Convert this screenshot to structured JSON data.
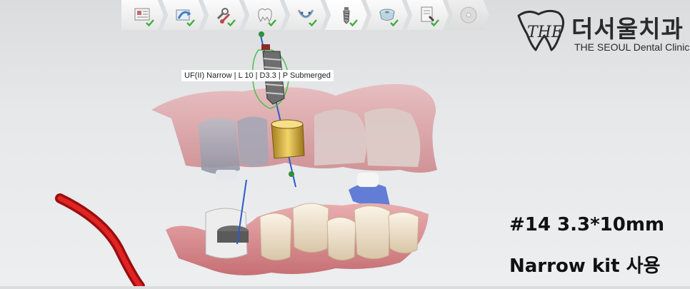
{
  "toolbar": {
    "steps": [
      {
        "icon": "patient-info-icon",
        "status": "done"
      },
      {
        "icon": "scan-import-icon",
        "status": "done"
      },
      {
        "icon": "tools-icon",
        "status": "done"
      },
      {
        "icon": "crown-icon",
        "status": "done"
      },
      {
        "icon": "nerve-canal-icon",
        "status": "done"
      },
      {
        "icon": "implant-icon",
        "status": "done"
      },
      {
        "icon": "sleeve-icon",
        "status": "done"
      },
      {
        "icon": "report-icon",
        "status": "done"
      },
      {
        "icon": "disc-export-icon",
        "status": "pending"
      }
    ]
  },
  "logo": {
    "mark": "THE",
    "name_kr": "더서울치과",
    "name_en": "THE SEOUL Dental Clinic"
  },
  "viewport": {
    "implant_tooltip": "UF(II) Narrow | L 10 | D3.3 | P Submerged"
  },
  "annotation": {
    "line1": "#14  3.3*10mm",
    "line2": "Narrow kit 사용"
  },
  "colors": {
    "check": "#3fae3a",
    "implant_axis": "#2b5bc8",
    "nerve_canal": "#d11a1a",
    "gingiva": "#d98c90"
  }
}
